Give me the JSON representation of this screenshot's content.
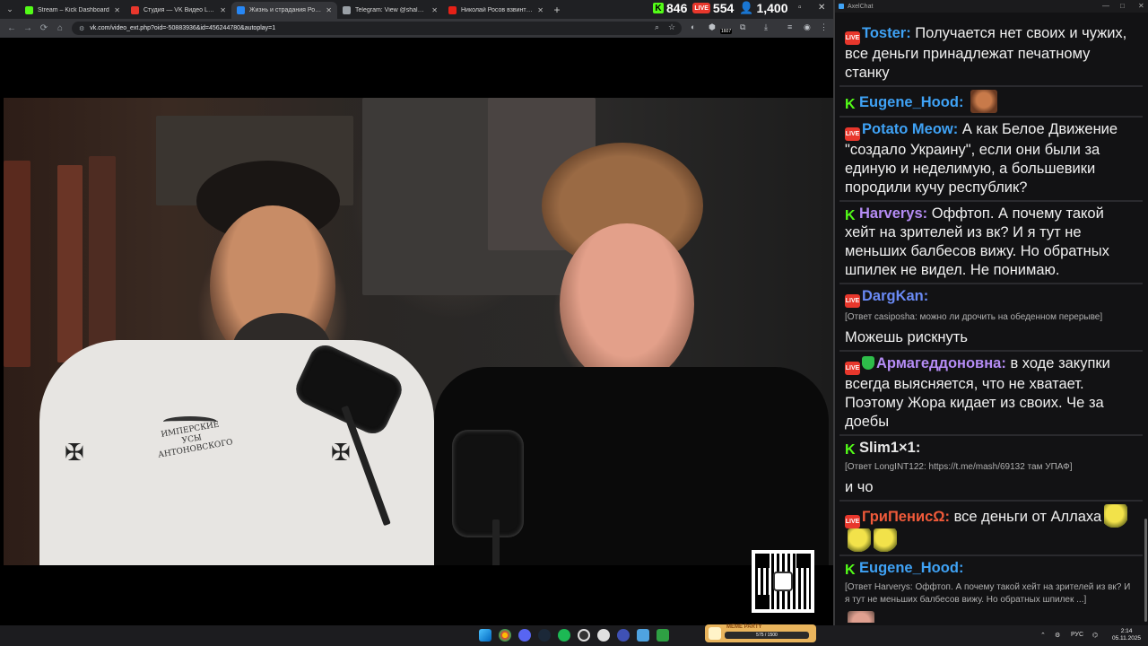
{
  "browser": {
    "tabs": [
      {
        "title": "Stream – Kick Dashboard",
        "color": "#53fc18",
        "active": false
      },
      {
        "title": "Студия — VK Видео Live",
        "color": "#e8372c",
        "active": false
      },
      {
        "title": "Жизнь и страдания Роман…",
        "color": "#2787f5",
        "active": true
      },
      {
        "title": "Telegram: View @shalnyak",
        "color": "#9aa0a6",
        "active": false
      },
      {
        "title": "Николай Росов взвинтит дома…",
        "color": "#e62117",
        "active": false
      }
    ],
    "url": "vk.com/video_ext.php?oid=-50883936&id=456244780&autoplay=1",
    "extension_count": "1607"
  },
  "stream_stats": {
    "kick_viewers": "846",
    "vk_viewers": "554",
    "total_viewers": "1,400",
    "live_label": "LIVE"
  },
  "video": {
    "shirt_text": "ИМПЕРСКИЕ УСЫ АНТОНОВСКОГО"
  },
  "chat": {
    "window_title": "AxelChat",
    "messages": [
      {
        "platform": "vk",
        "user": "Toster",
        "color": "#3fa2f5",
        "text": "Получается нет своих и чужих, все деньги принадлежат печатному станку"
      },
      {
        "platform": "kick",
        "user": "Eugene_Hood",
        "color": "#3fa2f5",
        "text": "",
        "emote": "face"
      },
      {
        "platform": "vk",
        "user": "Potato Meow",
        "color": "#3fa2f5",
        "text": "А как Белое Движение \"создало Украину\", если они были за единую и неделимую, а большевики породили кучу республик?"
      },
      {
        "platform": "kick",
        "user": "Harverys",
        "color": "#b58cf5",
        "text": "Оффтоп. А почему такой хейт на зрителей из вк? И я тут не меньших балбесов вижу. Но обратных шпилек не видел. Не понимаю."
      },
      {
        "platform": "vk",
        "user": "DargKan",
        "color": "#6a8af5",
        "reply": "[Ответ casiposha: можно ли дрочить на обеденном перерыве]",
        "text": "Можешь рискнуть"
      },
      {
        "platform": "vk-mod",
        "user": "Армагеддоновна",
        "color": "#b58cf5",
        "text": "в ходе закупки всегда выясняется, что не хватает. Поэтому Жора кидает из своих. Че за доебы"
      },
      {
        "platform": "kick",
        "user": "Slim1×1",
        "color": "#e8e8e8",
        "reply": "[Ответ LongINT122: https://t.me/mash/69132 там УПАФ]",
        "text": "и чо"
      },
      {
        "platform": "vk",
        "user": "ГриПенисΩ",
        "color": "#f05a3a",
        "text": "все деньги от Аллаха",
        "emote": "yellow"
      },
      {
        "platform": "kick",
        "user": "Eugene_Hood",
        "color": "#3fa2f5",
        "reply": "[Ответ Harverys: Оффтоп. А почему такой хейт на зрителей из вк? И я тут не меньших балбесов вижу. Но обратных шпилек ...]",
        "text": "",
        "emote": "avatar"
      }
    ]
  },
  "taskbar": {
    "widget_title": "MEME PARTY",
    "widget_progress": "575 / 1500",
    "lang": "РУС",
    "time": "2:14",
    "date": "05.11.2025"
  }
}
